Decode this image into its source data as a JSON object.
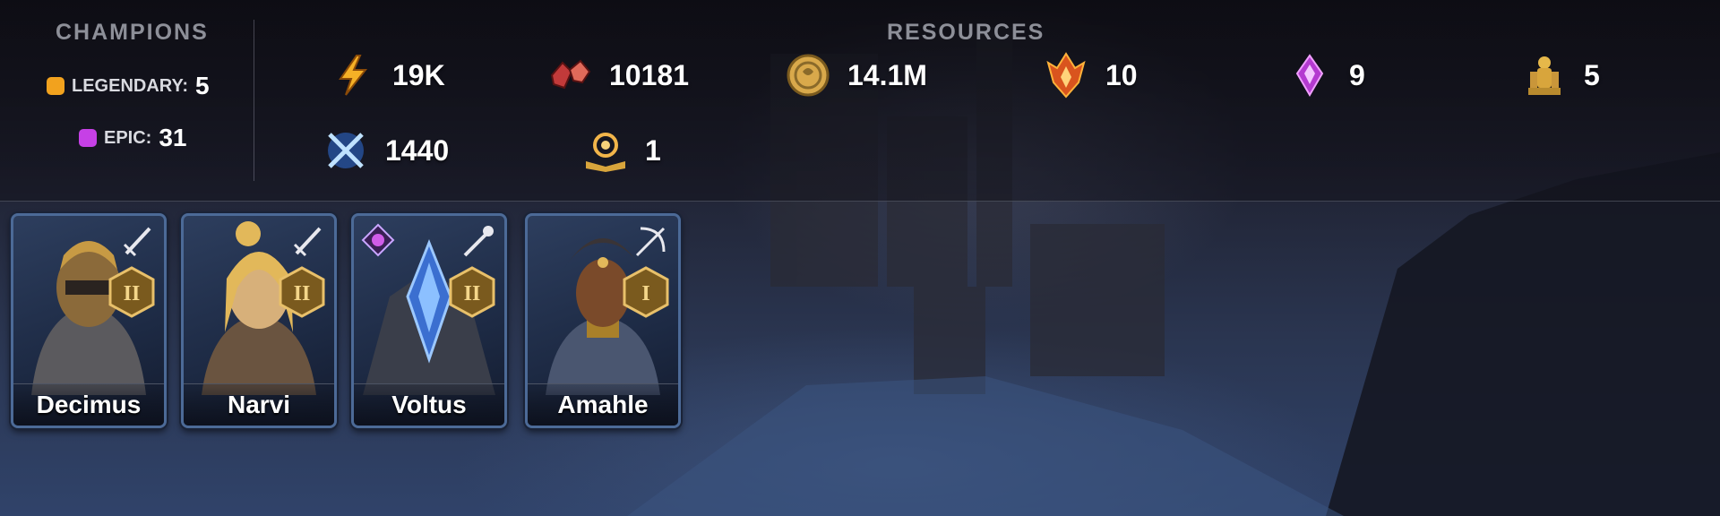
{
  "champions": {
    "title": "CHAMPIONS",
    "legendary": {
      "label": "LEGENDARY:",
      "count": "5",
      "color": "#f2a21e"
    },
    "epic": {
      "label": "EPIC:",
      "count": "31",
      "color": "#c640e6"
    }
  },
  "resources": {
    "title": "RESOURCES",
    "items": [
      {
        "icon": "energy-icon",
        "value": "19K"
      },
      {
        "icon": "rubies-icon",
        "value": "10181"
      },
      {
        "icon": "silver-coin-icon",
        "value": "14.1M"
      },
      {
        "icon": "fire-fragment-icon",
        "value": "10"
      },
      {
        "icon": "void-shard-icon",
        "value": "9"
      },
      {
        "icon": "gold-statue-icon",
        "value": "5"
      },
      {
        "icon": "arena-swords-icon",
        "value": "1440"
      },
      {
        "icon": "tome-icon",
        "value": "1"
      }
    ]
  },
  "cards": [
    {
      "name": "Decimus",
      "rank": "II",
      "role_icon": "sword-role-icon",
      "affinity": "",
      "skin": "#8b6a3a"
    },
    {
      "name": "Narvi",
      "rank": "II",
      "role_icon": "sword-role-icon",
      "affinity": "",
      "skin": "#d7b07a"
    },
    {
      "name": "Voltus",
      "rank": "II",
      "role_icon": "staff-role-icon",
      "affinity": "void-affinity-icon",
      "skin": "#3b6fd0"
    },
    {
      "name": "Amahle",
      "rank": "I",
      "role_icon": "bow-role-icon",
      "affinity": "",
      "skin": "#7a4a2a"
    }
  ]
}
